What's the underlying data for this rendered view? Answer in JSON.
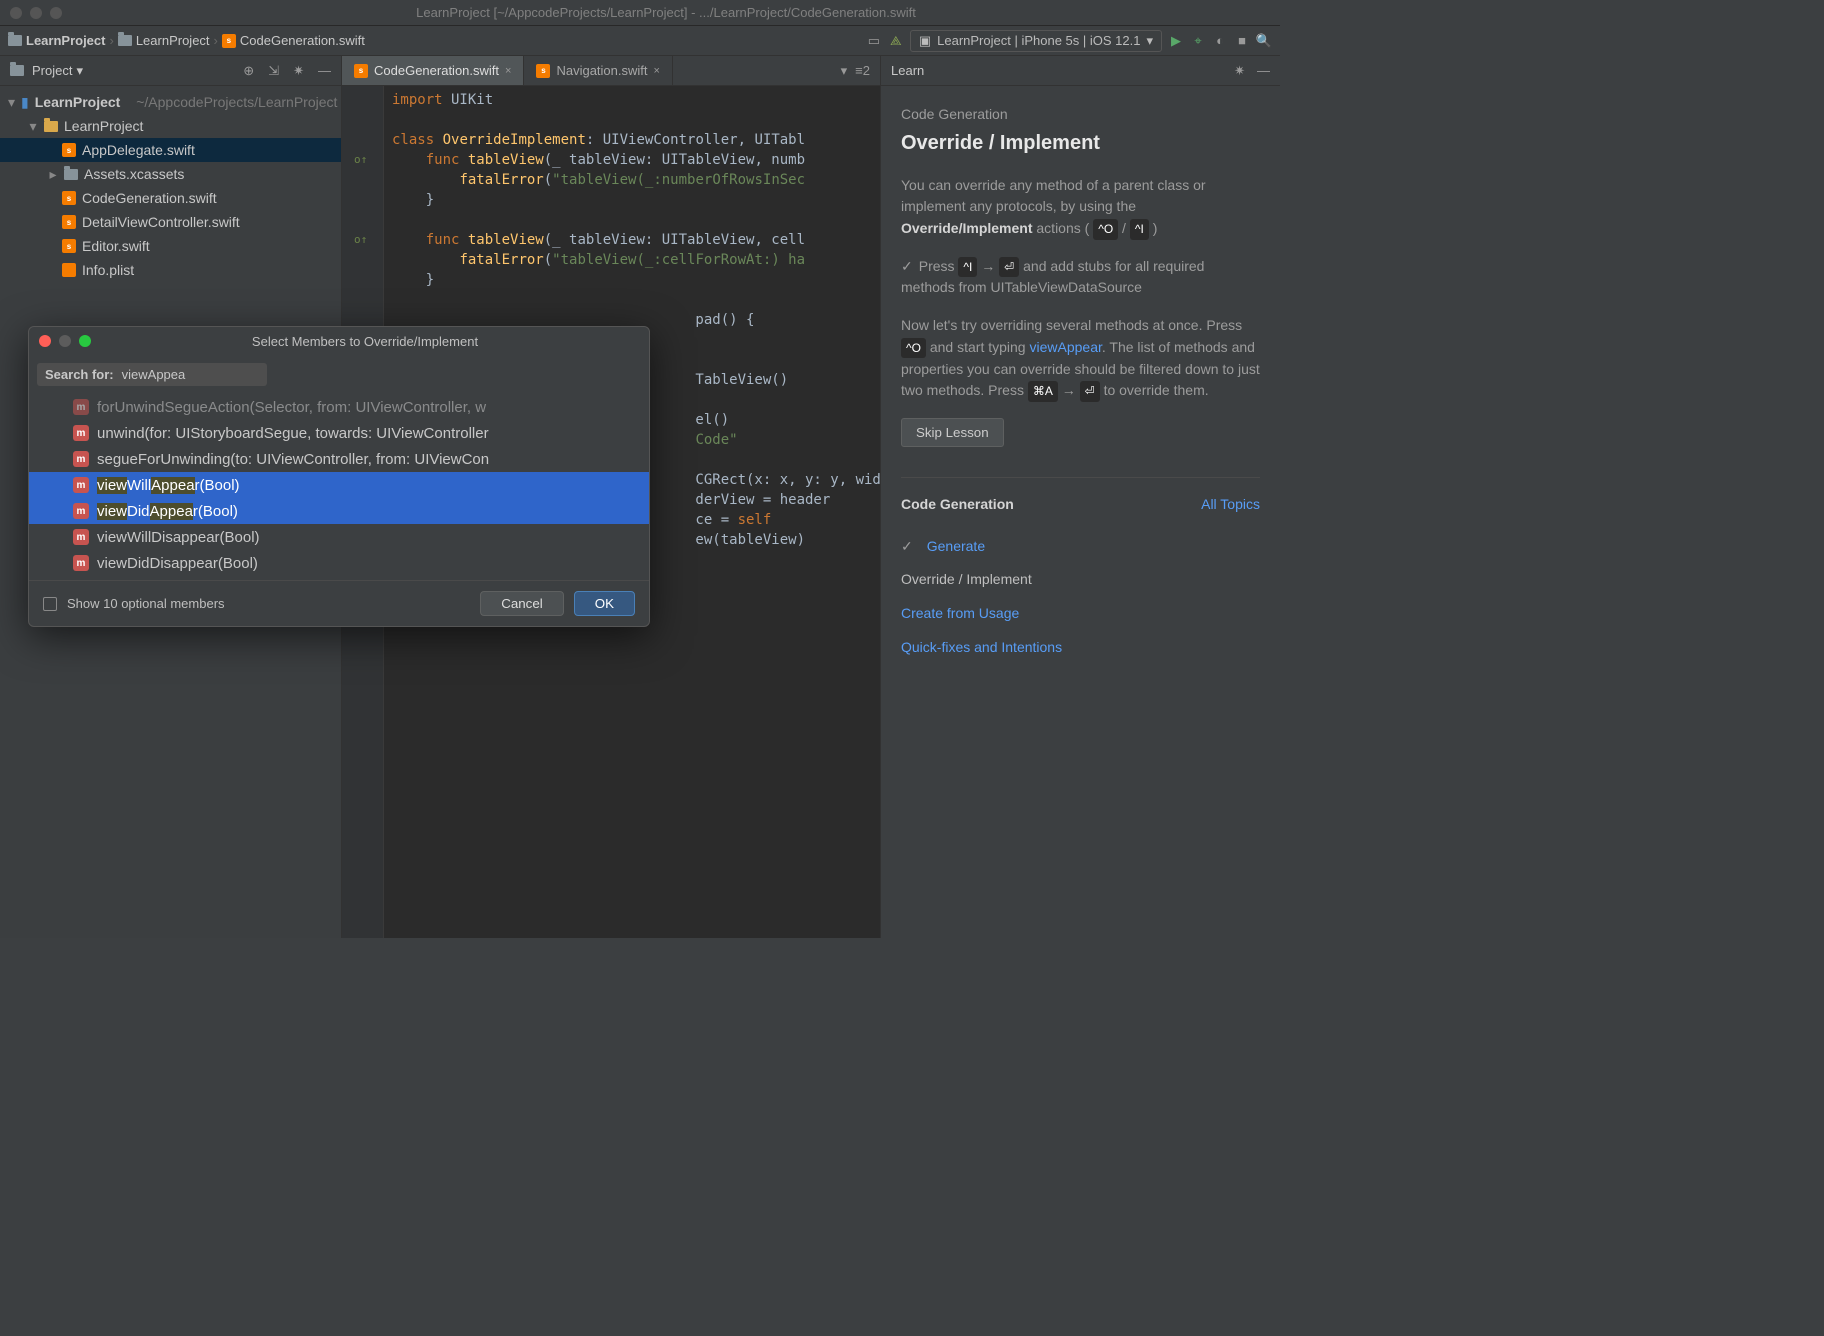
{
  "window": {
    "title": "LearnProject [~/AppcodeProjects/LearnProject] - .../LearnProject/CodeGeneration.swift"
  },
  "breadcrumb": {
    "c1": "LearnProject",
    "c2": "LearnProject",
    "c3": "CodeGeneration.swift"
  },
  "runconfig": {
    "label": "LearnProject | iPhone 5s | iOS 12.1"
  },
  "sidebar": {
    "header": "Project",
    "root_label": "LearnProject",
    "root_path": "~/AppcodeProjects/LearnProject",
    "folder1": "LearnProject",
    "files": [
      "AppDelegate.swift",
      "Assets.xcassets",
      "CodeGeneration.swift",
      "DetailViewController.swift",
      "Editor.swift",
      "Info.plist"
    ]
  },
  "tabs": {
    "t1": "CodeGeneration.swift",
    "t2": "Navigation.swift",
    "right": "≡2"
  },
  "code": "import UIKit\n\nclass OverrideImplement: UIViewController, UITabl\n    func tableView(_ tableView: UITableView, numb\n        fatalError(\"tableView(_:numberOfRowsInSec\n    }\n\n    func tableView(_ tableView: UITableView, cell\n        fatalError(\"tableView(_:cellForRowAt:) ha\n    }\n\n                                    pad() {\n\n\n                                    TableView()\n\n                                    el()\n                                    Code\"\n\n                                    CGRect(x: x, y: y, widt\n                                    derView = header\n                                    ce = self\n                                    ew(tableView)\n    }\n\n}",
  "learn": {
    "title": "Learn",
    "section": "Code Generation",
    "h2": "Override / Implement",
    "p1a": "You can override any method of a parent class or implement any protocols, by using the ",
    "p1b": "Override/Implement",
    "p1c": " actions ( ",
    "p1d": " / ",
    "p1e": " )",
    "k1": "^O",
    "k2": "^I",
    "p2a": "Press ",
    "p2b": " → ",
    "p2c": " and add stubs for all required methods from UITableViewDataSource",
    "k3": "^I",
    "k4": "⏎",
    "p3a": "Now let's try overriding several methods at once. Press ",
    "p3b": " and start typing ",
    "p3c": "viewAppear",
    "p3d": ". The list of methods and properties you can override should be filtered down to just two methods. Press ",
    "p3e": " → ",
    "p3f": " to override them.",
    "k5": "^O",
    "k6": "⌘A",
    "k7": "⏎",
    "skip": "Skip Lesson",
    "footer_title": "Code Generation",
    "all_topics": "All Topics",
    "items": [
      "Generate",
      "Override / Implement",
      "Create from Usage",
      "Quick-fixes and Intentions"
    ]
  },
  "dialog": {
    "title": "Select Members to Override/Implement",
    "search_label": "Search for:",
    "search_query": "viewAppea",
    "members": [
      {
        "text": "forUnwindSegueAction(Selector, from: UIViewController, w",
        "sel": false,
        "hl": false,
        "dim": true
      },
      {
        "text": "unwind(for: UIStoryboardSegue, towards: UIViewController",
        "sel": false,
        "hl": false
      },
      {
        "text": "segueForUnwinding(to: UIViewController, from: UIViewCon",
        "sel": false,
        "hl": false
      },
      {
        "text": "viewWillAppear(Bool)",
        "sel": true,
        "hl": true
      },
      {
        "text": "viewDidAppear(Bool)",
        "sel": true,
        "hl": true
      },
      {
        "text": "viewWillDisappear(Bool)",
        "sel": false,
        "hl": false
      },
      {
        "text": "viewDidDisappear(Bool)",
        "sel": false,
        "hl": false
      }
    ],
    "optional": "Show 10 optional members",
    "cancel": "Cancel",
    "ok": "OK"
  }
}
